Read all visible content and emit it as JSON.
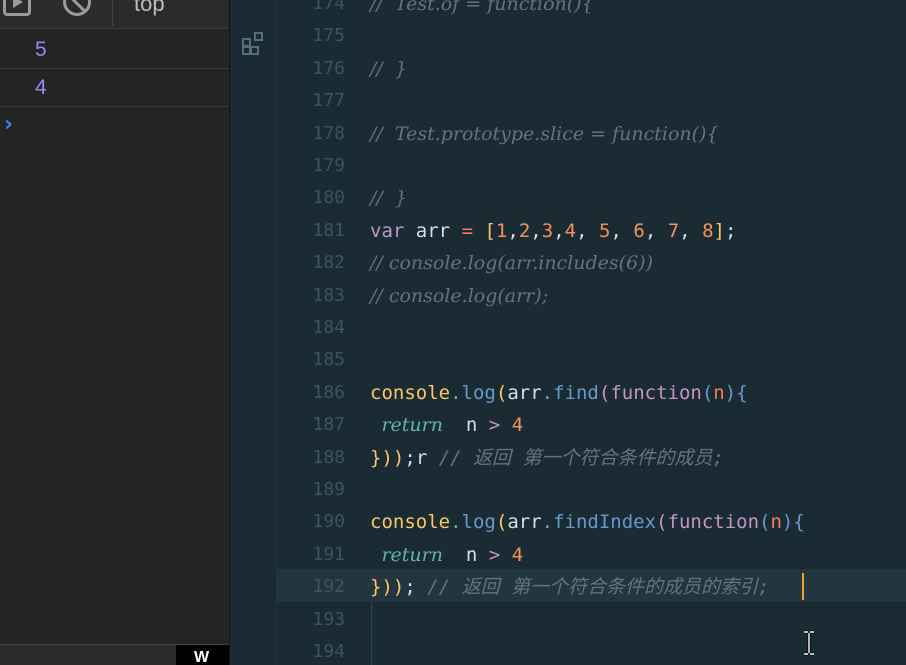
{
  "console": {
    "context": "top",
    "outputs": [
      "5",
      "4"
    ],
    "prompt": "›",
    "bottom_tab": "W"
  },
  "editor": {
    "lines": [
      {
        "num": "174",
        "text": "//  Test.of = function(){"
      },
      {
        "num": "175",
        "text": ""
      },
      {
        "num": "176",
        "text": "//  }"
      },
      {
        "num": "177",
        "text": ""
      },
      {
        "num": "178",
        "text": "//  Test.prototype.slice = function(){"
      },
      {
        "num": "179",
        "text": ""
      },
      {
        "num": "180",
        "text": "//  }"
      },
      {
        "num": "181",
        "text": "var arr = [1,2,3,4, 5, 6, 7, 8];"
      },
      {
        "num": "182",
        "text": "// console.log(arr.includes(6))"
      },
      {
        "num": "183",
        "text": "// console.log(arr);"
      },
      {
        "num": "184",
        "text": ""
      },
      {
        "num": "185",
        "text": ""
      },
      {
        "num": "186",
        "text": "console.log(arr.find(function(n){"
      },
      {
        "num": "187",
        "text": " return  n > 4"
      },
      {
        "num": "188",
        "text": "}));r // 返回 第一个符合条件的成员;"
      },
      {
        "num": "189",
        "text": ""
      },
      {
        "num": "190",
        "text": "console.log(arr.findIndex(function(n){"
      },
      {
        "num": "191",
        "text": " return  n > 4"
      },
      {
        "num": "192",
        "text": "})); // 返回 第一个符合条件的成员的索引;"
      },
      {
        "num": "193",
        "text": ""
      },
      {
        "num": "194",
        "text": ""
      }
    ]
  },
  "colors": {
    "editor_bg": "#1b2b34",
    "comment": "#65737e",
    "keyword": "#c594c5",
    "number": "#f99157",
    "function": "#6699cc",
    "console_value": "#9b87f5",
    "cursor": "#f0a030"
  },
  "icons": {
    "toolbar": [
      "play-icon",
      "block-icon"
    ],
    "activity": [
      "extensions-icon"
    ],
    "pointer": "ibeam-cursor-icon"
  }
}
